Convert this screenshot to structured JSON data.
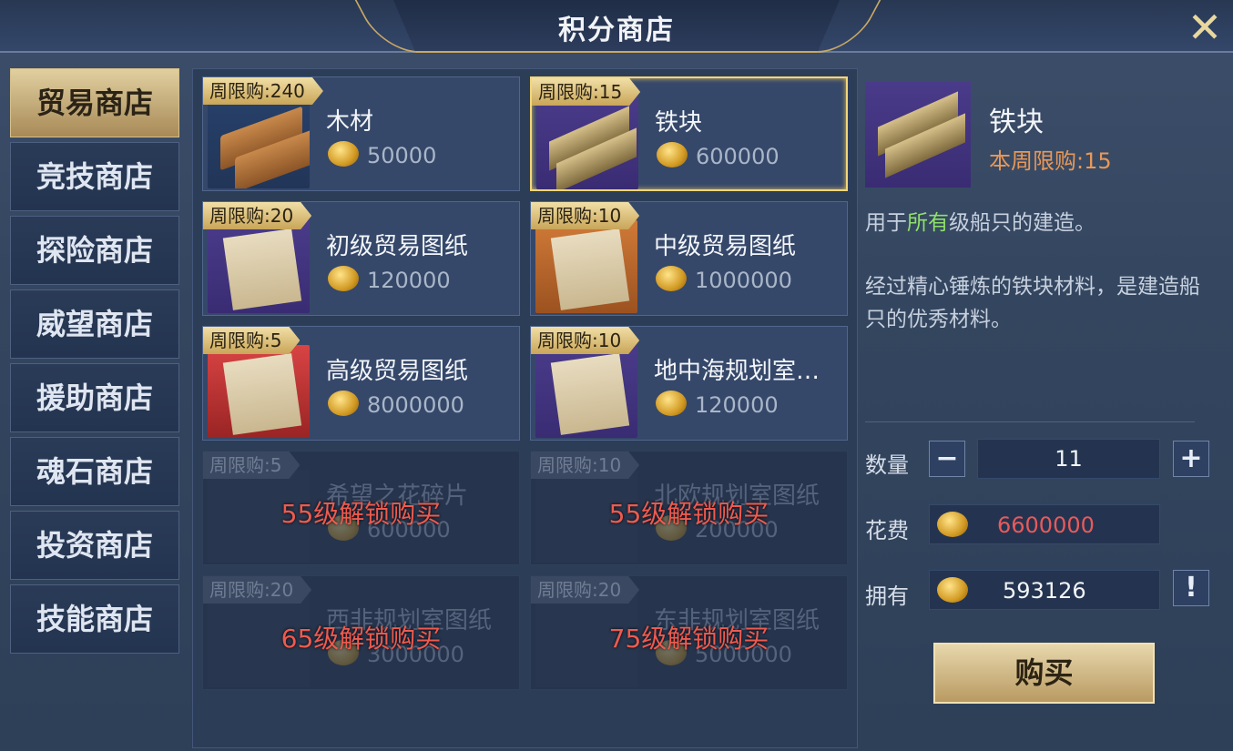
{
  "title": "积分商店",
  "close_icon": "close-x-icon",
  "sidebar": {
    "items": [
      {
        "label": "贸易商店",
        "active": true
      },
      {
        "label": "竞技商店"
      },
      {
        "label": "探险商店"
      },
      {
        "label": "威望商店"
      },
      {
        "label": "援助商店"
      },
      {
        "label": "魂石商店"
      },
      {
        "label": "投资商店"
      },
      {
        "label": "技能商店"
      }
    ]
  },
  "items": [
    {
      "limit": "周限购:240",
      "name": "木材",
      "price": "50000"
    },
    {
      "limit": "周限购:15",
      "name": "铁块",
      "price": "600000",
      "selected": true
    },
    {
      "limit": "周限购:20",
      "name": "初级贸易图纸",
      "price": "120000"
    },
    {
      "limit": "周限购:10",
      "name": "中级贸易图纸",
      "price": "1000000"
    },
    {
      "limit": "周限购:5",
      "name": "高级贸易图纸",
      "price": "8000000"
    },
    {
      "limit": "周限购:10",
      "name": "地中海规划室…",
      "price": "120000"
    },
    {
      "limit": "周限购:5",
      "name": "希望之花碎片",
      "price": "600000",
      "lock": "55级解锁购买"
    },
    {
      "limit": "周限购:10",
      "name": "北欧规划室图纸",
      "price": "200000",
      "lock": "55级解锁购买"
    },
    {
      "limit": "周限购:20",
      "name": "西非规划室图纸",
      "price": "3000000",
      "lock": "65级解锁购买"
    },
    {
      "limit": "周限购:20",
      "name": "东非规划室图纸",
      "price": "5000000",
      "lock": "75级解锁购买"
    }
  ],
  "detail": {
    "name": "铁块",
    "limit": "本周限购:15",
    "desc_prefix": "用于",
    "desc_highlight": "所有",
    "desc_suffix": "级船只的建造。",
    "desc2": "经过精心锤炼的铁块材料，是建造船只的优秀材料。",
    "qty_label": "数量",
    "qty": "11",
    "minus": "−",
    "plus": "+",
    "cost_label": "花费",
    "cost": "6600000",
    "own_label": "拥有",
    "own": "593126",
    "info": "!",
    "buy": "购买"
  },
  "colors": {
    "accent_gold": "#c9a864",
    "cost_red": "#e85a5a",
    "highlight_green": "#8fe06a",
    "limit_orange": "#e89858"
  }
}
